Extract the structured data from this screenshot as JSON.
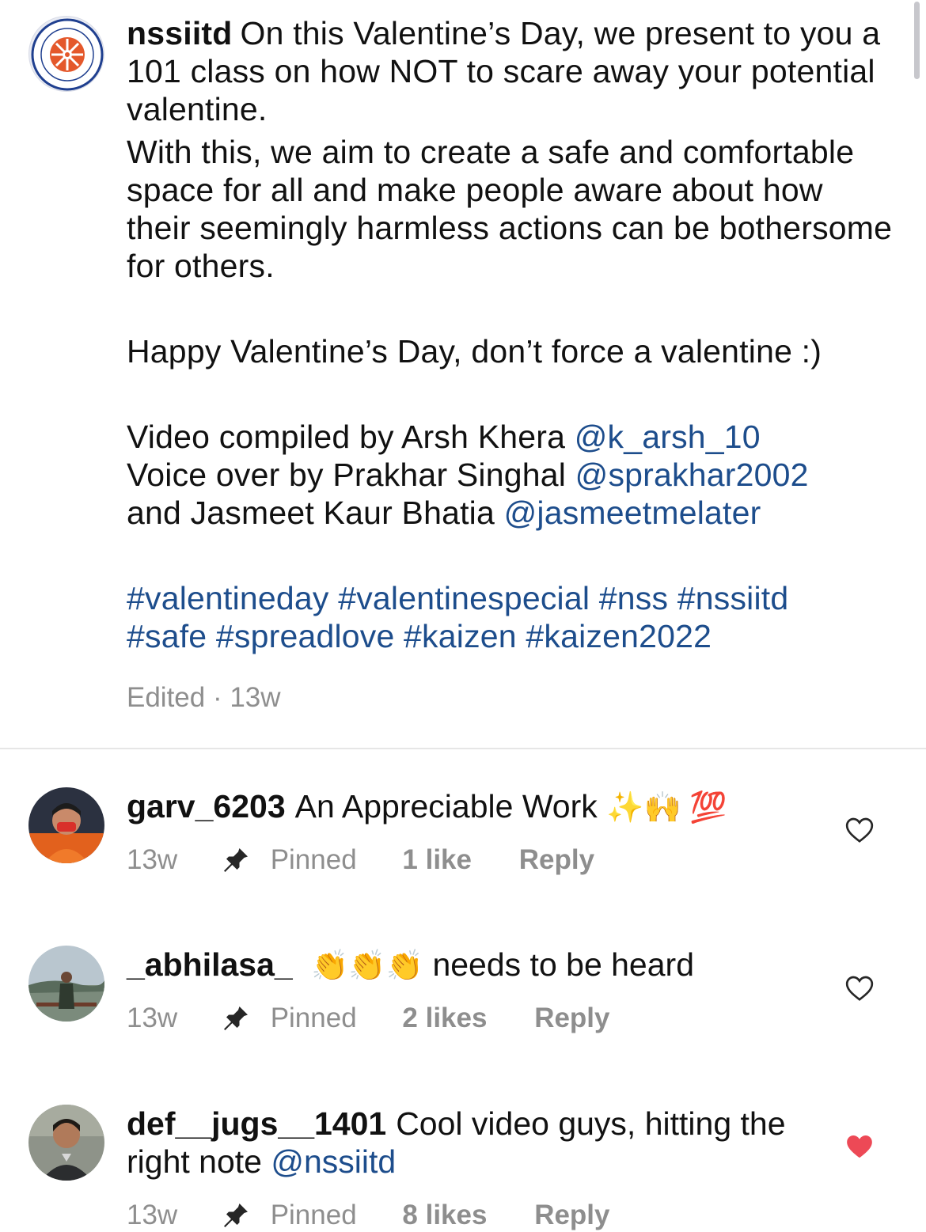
{
  "post": {
    "username": "nssiitd",
    "avatar_alt": "nss-logo",
    "line1": "On this Valentine’s Day, we present to you a 101 class on how NOT to scare away your potential valentine.",
    "line2": "With this, we aim to create a safe and comfortable space for all and make people aware about how their seemingly harmless actions can be bothersome for others.",
    "line3": "Happy Valentine’s Day, don’t force a valentine :)",
    "credit1_text": "Video compiled by Arsh Khera",
    "credit1_mention": "@k_arsh_10",
    "credit2_text": "Voice over by Prakhar Singhal",
    "credit2_mention": "@sprakhar2002",
    "credit3_text": "and Jasmeet Kaur Bhatia",
    "credit3_mention": "@jasmeetmelater",
    "hashtags_line1": "#valentineday #valentinespecial #nss #nssiitd",
    "hashtags_line2": "#safe #spreadlove #kaizen #kaizen2022",
    "meta": "Edited · 13w"
  },
  "comments": [
    {
      "username": "garv_6203",
      "text": "An Appreciable Work",
      "emojis": "✨🙌 💯",
      "time": "13w",
      "pinned_label": "Pinned",
      "likes": "1 like",
      "reply_label": "Reply",
      "liked": false
    },
    {
      "username": "_abhilasa_",
      "emojis": "👏👏👏",
      "text": "needs to be heard",
      "time": "13w",
      "pinned_label": "Pinned",
      "likes": "2 likes",
      "reply_label": "Reply",
      "liked": false
    },
    {
      "username": "def__jugs__1401",
      "text": "Cool video guys, hitting the right note",
      "mention": "@nssiitd",
      "time": "13w",
      "pinned_label": "Pinned",
      "likes": "8 likes",
      "reply_label": "Reply",
      "liked": true
    }
  ],
  "colors": {
    "link": "#1d4d8c",
    "meta": "#8e8e8e",
    "heart_liked": "#ed4956"
  },
  "icons": [
    "nss-logo-icon",
    "pin-icon",
    "heart-outline-icon",
    "heart-filled-icon"
  ]
}
